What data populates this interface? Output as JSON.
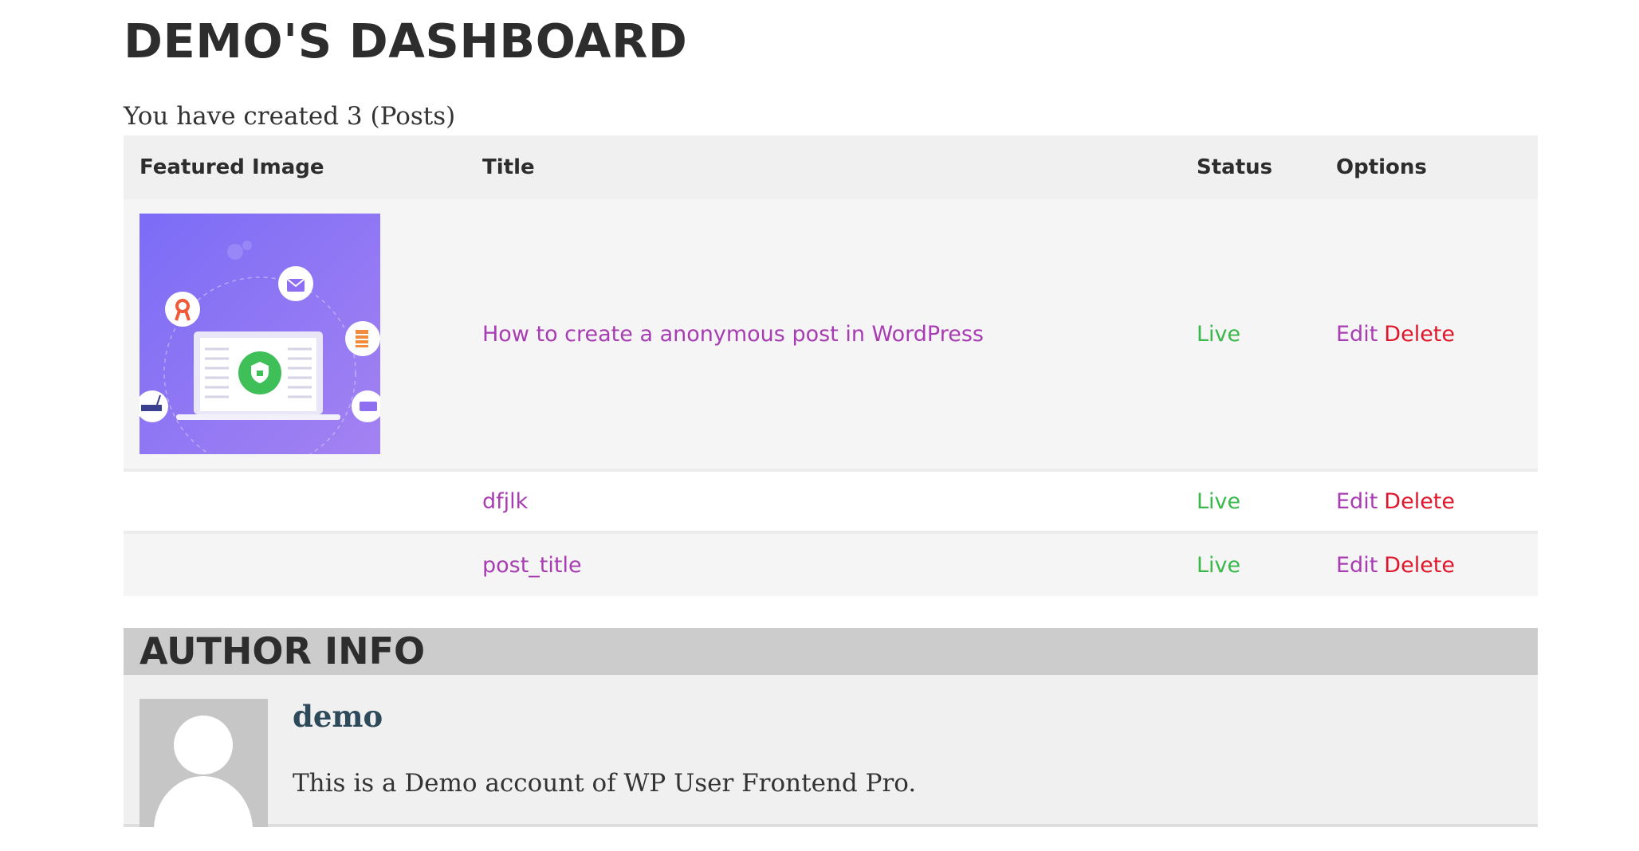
{
  "page": {
    "title": "DEMO'S DASHBOARD",
    "post_count_text": "You have created 3 (Posts)"
  },
  "posts_table": {
    "headers": [
      "Featured Image",
      "Title",
      "Status",
      "Options"
    ],
    "rows": [
      {
        "title": "How to create a anonymous post in WordPress",
        "status": "Live",
        "edit": "Edit",
        "delete": "Delete",
        "has_image": true
      },
      {
        "title": "dfjlk",
        "status": "Live",
        "edit": "Edit",
        "delete": "Delete",
        "has_image": false
      },
      {
        "title": "post_title",
        "status": "Live",
        "edit": "Edit",
        "delete": "Delete",
        "has_image": false
      }
    ]
  },
  "author": {
    "section_title": "AUTHOR INFO",
    "name": "demo",
    "bio": "This is a Demo account of WP User Frontend Pro."
  },
  "colors": {
    "link": "#a83cb2",
    "live": "#3bb84a",
    "delete": "#e0162b",
    "thumb_gradient_start": "#7b6cf6",
    "thumb_gradient_end": "#a482f2"
  }
}
